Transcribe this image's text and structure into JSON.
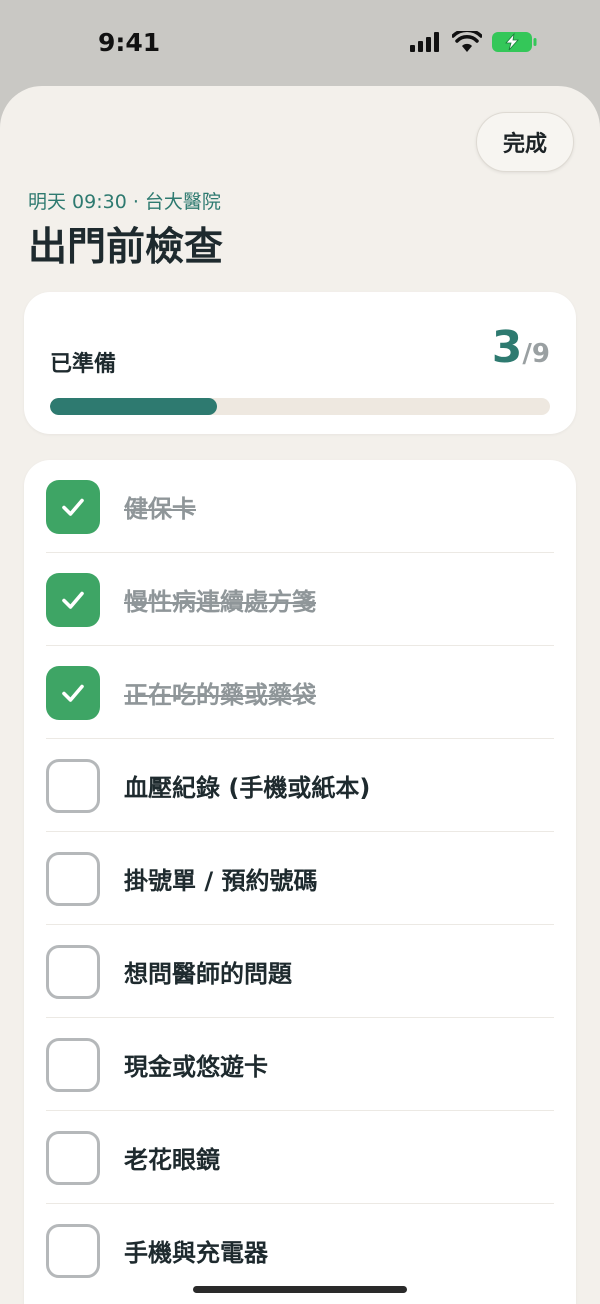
{
  "status": {
    "time": "9:41",
    "icons": [
      "signal-icon",
      "wifi-icon",
      "battery-charging-icon"
    ],
    "battery_color": "#34c759"
  },
  "header": {
    "done_label": "完成",
    "subtitle": "明天 09:30 · 台大醫院",
    "title": "出門前檢查"
  },
  "progress": {
    "label": "已準備",
    "done": "3",
    "total": "/9",
    "fraction": 0.333
  },
  "checklist": {
    "items": [
      {
        "label": "健保卡",
        "checked": true
      },
      {
        "label": "慢性病連續處方箋",
        "checked": true
      },
      {
        "label": "正在吃的藥或藥袋",
        "checked": true
      },
      {
        "label": "血壓紀錄 (手機或紙本)",
        "checked": false
      },
      {
        "label": "掛號單 / 預約號碼",
        "checked": false
      },
      {
        "label": "想問醫師的問題",
        "checked": false
      },
      {
        "label": "現金或悠遊卡",
        "checked": false
      },
      {
        "label": "老花眼鏡",
        "checked": false
      },
      {
        "label": "手機與充電器",
        "checked": false
      }
    ]
  },
  "colors": {
    "accent": "#2e7a70",
    "checked": "#3ea565",
    "background": "#f3f0eb"
  }
}
